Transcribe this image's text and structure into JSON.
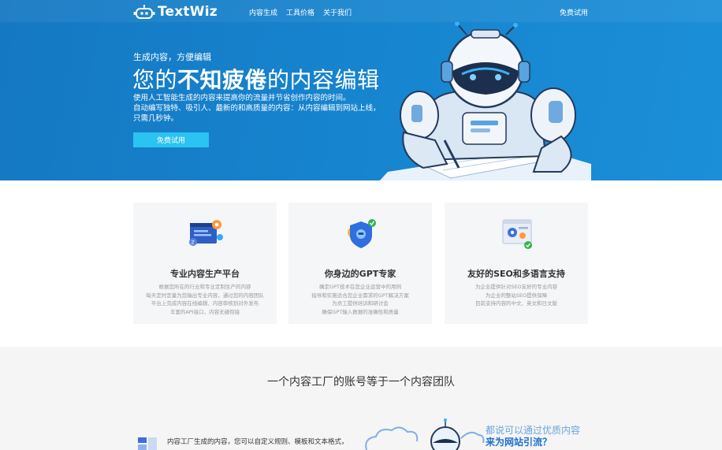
{
  "brand": {
    "name": "TextWiz"
  },
  "nav": {
    "items": [
      {
        "label": "内容生成"
      },
      {
        "label": "工具价格"
      },
      {
        "label": "关于我们"
      }
    ],
    "trial": "免费试用"
  },
  "hero": {
    "tagline": "生成内容，方便编辑",
    "headline_pre": "您的",
    "headline_bold": "不知疲倦",
    "headline_post": "的内容编辑",
    "desc": [
      "使用人工智能生成的内容来提高你的流量并节省创作内容的时间。",
      "自动编写独特、吸引人、最新的和高质量的内容：从内容编辑到网站上线，",
      "只需几秒钟。"
    ],
    "button": "免费试用"
  },
  "features": [
    {
      "icon": "code-gear-icon",
      "title": "专业内容生产平台",
      "lines": [
        "根据您所在的行业和专业定制生产的内容",
        "每天定时定量为您输出专业内容，通过您的内容团队",
        "平台上完成内容在线编辑、内容审核到对外发布",
        "丰富的API接口，内容无缝衔接"
      ]
    },
    {
      "icon": "ai-shield-icon",
      "title": "你身边的GPT专家",
      "lines": [
        "确定GPT技术在您企业运营中的用例",
        "指导和实施适合您企业需求的GPT解决方案",
        "为员工提供培训和研讨会",
        "确保GPT输入数据的准确性和质量"
      ]
    },
    {
      "icon": "seo-settings-icon",
      "title": "友好的SEO和多语言支持",
      "lines": [
        "为企业提供针对SEO友好的专业内容",
        "为企业的整站SEO提供保障",
        "目前支持内容的中文、英文和日文版"
      ]
    }
  ],
  "section2": {
    "title": "一个内容工厂的账号等于一个内容团队",
    "info_line": "内容工厂生成的内容，您可以自定义规则、模板和文本格式，",
    "info_line2": "",
    "promo1": "都说可以通过优质内容",
    "promo2": "来为网站引流？"
  },
  "colors": {
    "hero_bg": "#1683ce",
    "button": "#2bc3f2",
    "accent": "#1f6fd0"
  }
}
